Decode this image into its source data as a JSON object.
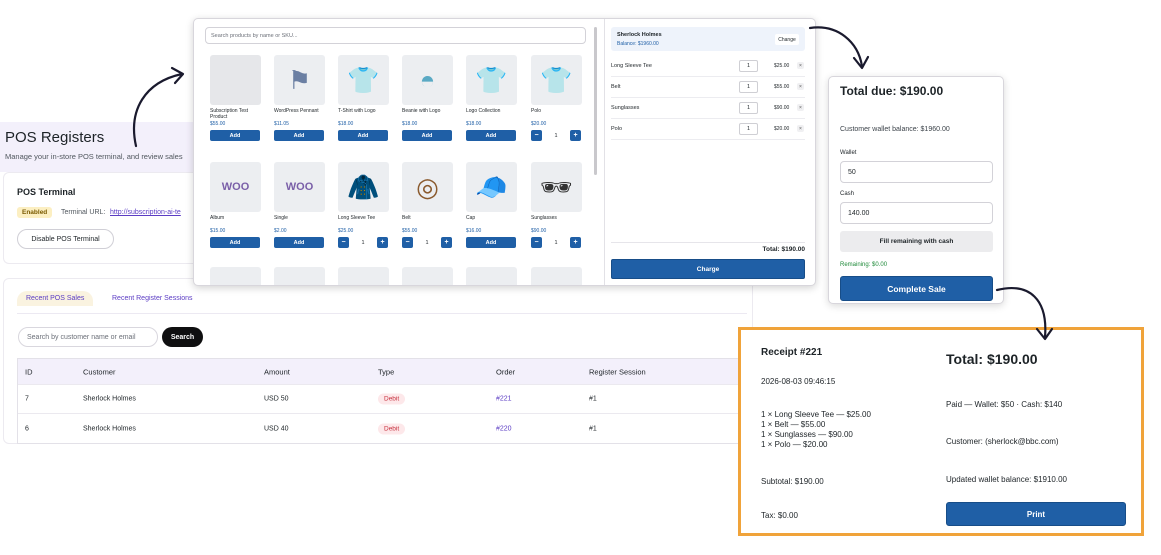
{
  "admin": {
    "title": "POS Registers",
    "subtitle": "Manage your in-store POS terminal, and review sales",
    "terminal": {
      "title": "POS Terminal",
      "status_badge": "Enabled",
      "url_label": "Terminal URL:",
      "url": "http://subscription-ai-te",
      "disable_button": "Disable POS Terminal"
    },
    "tabs": [
      "Recent POS Sales",
      "Recent Register Sessions"
    ],
    "search_placeholder": "Search by customer name or email",
    "search_button": "Search",
    "table": {
      "headers": [
        "ID",
        "Customer",
        "Amount",
        "Type",
        "Order",
        "Register Session"
      ],
      "rows": [
        {
          "id": "7",
          "customer": "Sherlock Holmes",
          "amount": "USD 50",
          "type": "Debit",
          "order": "#221",
          "session": "#1"
        },
        {
          "id": "6",
          "customer": "Sherlock Holmes",
          "amount": "USD 40",
          "type": "Debit",
          "order": "#220",
          "session": "#1"
        }
      ]
    }
  },
  "pos": {
    "search_placeholder": "Search products by name or SKU...",
    "products": [
      {
        "name": "Subscription Test Product",
        "price": "$55.00",
        "icon": "placeholder",
        "action": "add",
        "label": "Add"
      },
      {
        "name": "WordPress Pennant",
        "price": "$11.05",
        "icon": "pennant-icon",
        "action": "add",
        "label": "Add"
      },
      {
        "name": "T-Shirt with Logo",
        "price": "$18.00",
        "icon": "tshirt-icon",
        "action": "add",
        "label": "Add"
      },
      {
        "name": "Beanie with Logo",
        "price": "$18.00",
        "icon": "beanie-icon",
        "action": "add",
        "label": "Add"
      },
      {
        "name": "Logo Collection",
        "price": "$18.00",
        "icon": "collection-icon",
        "action": "add",
        "label": "Add"
      },
      {
        "name": "Polo",
        "price": "$20.00",
        "icon": "polo-icon",
        "action": "qty",
        "qty": "1"
      },
      {
        "name": "Album",
        "price": "$15.00",
        "icon": "album-icon",
        "action": "add",
        "label": "Add"
      },
      {
        "name": "Single",
        "price": "$2.00",
        "icon": "single-icon",
        "action": "add",
        "label": "Add"
      },
      {
        "name": "Long Sleeve Tee",
        "price": "$25.00",
        "icon": "longsleeve-icon",
        "action": "qty",
        "qty": "1"
      },
      {
        "name": "Belt",
        "price": "$55.00",
        "icon": "belt-icon",
        "action": "qty",
        "qty": "1"
      },
      {
        "name": "Cap",
        "price": "$16.00",
        "icon": "cap-icon",
        "action": "add",
        "label": "Add"
      },
      {
        "name": "Sunglasses",
        "price": "$90.00",
        "icon": "sunglasses-icon",
        "action": "qty",
        "qty": "1"
      }
    ],
    "customer": {
      "name": "Sherlock Holmes",
      "balance": "Balance: $1960.00",
      "change_button": "Change"
    },
    "cart": [
      {
        "name": "Long Sleeve Tee",
        "qty": "1",
        "price": "$25.00"
      },
      {
        "name": "Belt",
        "qty": "1",
        "price": "$55.00"
      },
      {
        "name": "Sunglasses",
        "qty": "1",
        "price": "$90.00"
      },
      {
        "name": "Polo",
        "qty": "1",
        "price": "$20.00"
      }
    ],
    "total": "Total: $190.00",
    "charge_button": "Charge"
  },
  "payment": {
    "total_due": "Total due: $190.00",
    "wallet_balance": "Customer wallet balance: $1960.00",
    "wallet_label": "Wallet",
    "wallet_value": "50",
    "cash_label": "Cash",
    "cash_value": "140.00",
    "fill_button": "Fill remaining with cash",
    "remaining": "Remaining: $0.00",
    "complete_button": "Complete Sale"
  },
  "receipt": {
    "title": "Receipt #221",
    "date": "2026-08-03 09:46:15",
    "items": [
      "1 × Long Sleeve Tee — $25.00",
      "1 × Belt — $55.00",
      "1 × Sunglasses — $90.00",
      "1 × Polo — $20.00"
    ],
    "subtotal": "Subtotal: $190.00",
    "tax": "Tax: $0.00",
    "total": "Total: $190.00",
    "paid": "Paid — Wallet: $50 · Cash: $140",
    "customer": "Customer: (sherlock@bbc.com)",
    "updated_balance": "Updated wallet balance: $1910.00",
    "print_button": "Print"
  },
  "colors": {
    "accent": "#1f5fa6",
    "link": "#5b3cc4",
    "highlight_border": "#f0a33a",
    "debit": "#c7323f"
  }
}
